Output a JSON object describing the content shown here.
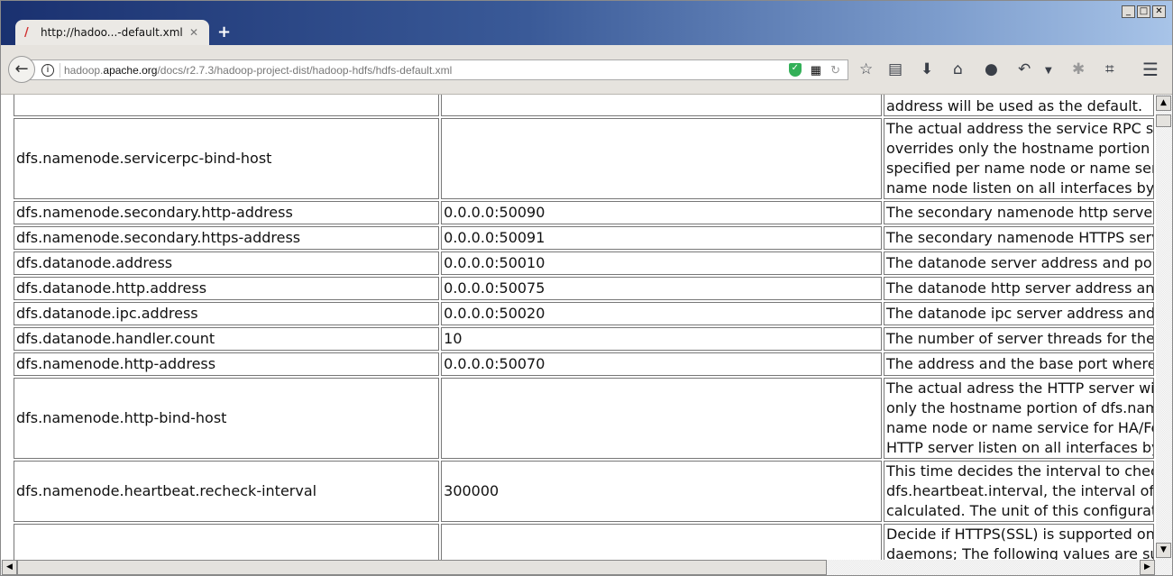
{
  "browser": {
    "tab_title": "http://hadoo...-default.xml",
    "url": {
      "prefix": "hadoop.",
      "domain": "apache.org",
      "path": "/docs/r2.7.3/hadoop-project-dist/hadoop-hdfs/hdfs-default.xml"
    }
  },
  "table": {
    "rows": [
      {
        "name": "",
        "value": "",
        "desc": [
          "address will be used as the default."
        ]
      },
      {
        "name": "dfs.namenode.servicerpc-bind-host",
        "value": "",
        "desc": [
          "The actual address the service RPC server",
          "overrides only the hostname portion of",
          "specified per name node or name service",
          "name node listen on all interfaces by s"
        ]
      },
      {
        "name": "dfs.namenode.secondary.http-address",
        "value": "0.0.0.0:50090",
        "desc": [
          "The secondary namenode http server address"
        ]
      },
      {
        "name": "dfs.namenode.secondary.https-address",
        "value": "0.0.0.0:50091",
        "desc": [
          "The secondary namenode HTTPS server"
        ]
      },
      {
        "name": "dfs.datanode.address",
        "value": "0.0.0.0:50010",
        "desc": [
          "The datanode server address and port"
        ]
      },
      {
        "name": "dfs.datanode.http.address",
        "value": "0.0.0.0:50075",
        "desc": [
          "The datanode http server address and"
        ]
      },
      {
        "name": "dfs.datanode.ipc.address",
        "value": "0.0.0.0:50020",
        "desc": [
          "The datanode ipc server address and p"
        ]
      },
      {
        "name": "dfs.datanode.handler.count",
        "value": "10",
        "desc": [
          "The number of server threads for the d"
        ]
      },
      {
        "name": "dfs.namenode.http-address",
        "value": "0.0.0.0:50070",
        "desc": [
          "The address and the base port where t"
        ]
      },
      {
        "name": "dfs.namenode.http-bind-host",
        "value": "",
        "desc": [
          "The actual adress the HTTP server will",
          "only the hostname portion of dfs.name",
          "name node or name service for HA/Fe",
          "HTTP server listen on all interfaces by s"
        ]
      },
      {
        "name": "dfs.namenode.heartbeat.recheck-interval",
        "value": "300000",
        "desc": [
          "This time decides the interval to check",
          "dfs.heartbeat.interval, the interval of d",
          "calculated. The unit of this configuration"
        ]
      },
      {
        "name": "",
        "value": "",
        "desc": [
          "Decide if HTTPS(SSL) is supported on H",
          "daemons; The following values are sup"
        ]
      }
    ]
  }
}
